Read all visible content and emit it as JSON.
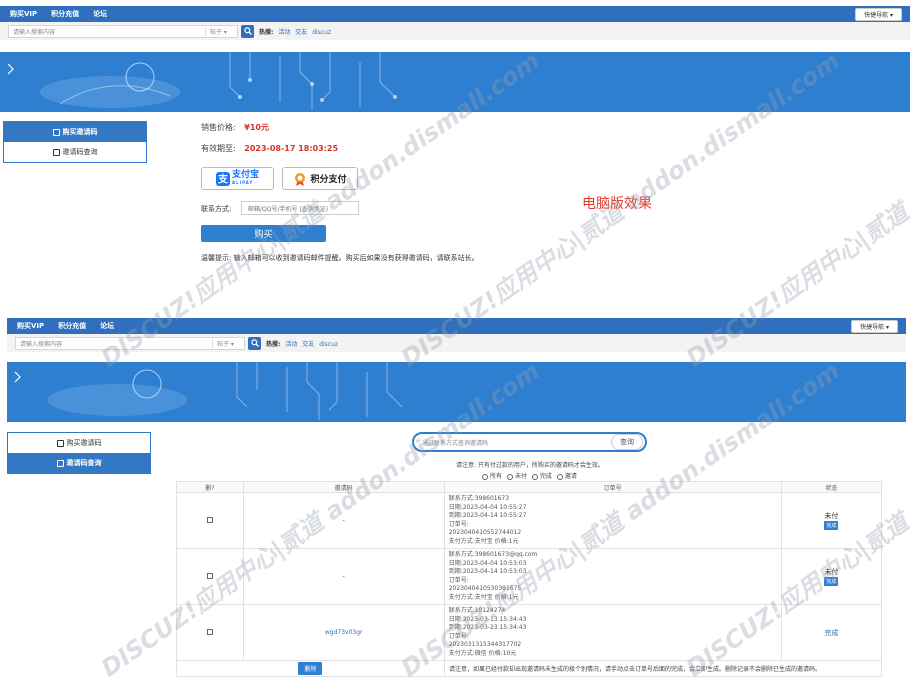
{
  "nav": {
    "items": [
      "购买VIP",
      "积分充值",
      "论坛"
    ],
    "quick": "快捷导航"
  },
  "search": {
    "placeholder": "请输入搜索内容",
    "type": "帖子",
    "hot_label": "热搜:",
    "hot_items": [
      "活动",
      "交友",
      "discuz"
    ]
  },
  "watermark": "DISCUZ!应用中心|贰道 addon.dismall.com",
  "sidebar": {
    "buy": "购买邀请码",
    "query": "邀请码查询"
  },
  "purchase": {
    "price_label": "销售价格:",
    "price": "¥10元",
    "expiry_label": "有效期至:",
    "expiry": "2023-08-17 18:03:25",
    "alipay": "支付宝",
    "alipay_sub": "ALIPAY",
    "points_pay": "积分支付",
    "contact_label": "联系方式:",
    "contact_placeholder": "邮箱/QQ号/手机号 (查询凭证)",
    "buy_button": "购买",
    "tip": "温馨提示: 输入邮箱可以收到邀请码邮件提醒。购买后如果没有获得邀请码，请联系站长。",
    "caption": "电脑版效果"
  },
  "query": {
    "placeholder": "通过联系方式查询邀请码",
    "button": "查询",
    "notice": "请注意: 只有付过款的用户，所购买的邀请码才会生效。",
    "filters": [
      "所有",
      "未付",
      "完成",
      "邀请"
    ],
    "headers": [
      "删?",
      "邀请码",
      "订单号",
      "状态"
    ],
    "rows": [
      {
        "code": "-",
        "info": "联系方式:398601673\n日期:2023-04-04 10:55:27\n到期:2023-04-14 10:55:27\n订单号:\n2023040410552744012\n支付方式:支付宝 价格:1元",
        "status": "未付",
        "status_btn": "完成"
      },
      {
        "code": "-",
        "info": "联系方式:398601673@qq.com\n日期:2023-04-04 10:53:03\n到期:2023-04-14 10:53:03\n订单号:\n2023040410530391675\n支付方式:支付宝 价格:1元",
        "status": "未付",
        "status_btn": "完成"
      },
      {
        "code": "wgd73v03gr",
        "info": "联系方式:10124274\n日期:2023-03-13 15:34:43\n到期:2023-03-23 15:34:43\n订单号:\n2023031315344317702\n支付方式:微信 价格:10元",
        "status": "完成",
        "status_btn": ""
      }
    ],
    "delete_button": "删除",
    "footer_note": "请注意，如果已经付款却出现邀请码未生成的极个别情况，请手动点击订单号后面的完成，会立即生成。删除记录不会删除已生成的邀请码。"
  },
  "colors": {
    "primary": "#2f7fd0",
    "price": "#d9322a",
    "nav": "#2f6fbe"
  }
}
